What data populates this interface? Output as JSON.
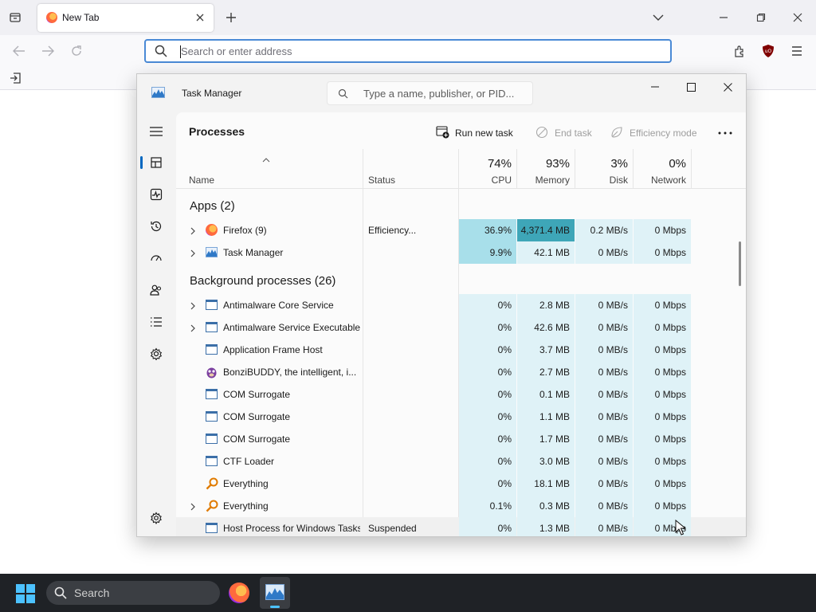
{
  "browser": {
    "tab_title": "New Tab",
    "url_placeholder": "Search or enter address"
  },
  "taskmgr": {
    "title": "Task Manager",
    "search_placeholder": "Type a name, publisher, or PID...",
    "page_title": "Processes",
    "run_new_task": "Run new task",
    "end_task": "End task",
    "efficiency_mode": "Efficiency mode",
    "columns": {
      "name": "Name",
      "status": "Status",
      "cpu_pct": "74%",
      "cpu": "CPU",
      "mem_pct": "93%",
      "mem": "Memory",
      "disk_pct": "3%",
      "disk": "Disk",
      "net_pct": "0%",
      "net": "Network"
    },
    "apps_group": "Apps (2)",
    "bg_group": "Background processes (26)",
    "apps": [
      {
        "name": "Firefox (9)",
        "status": "Efficiency...",
        "cpu": "36.9%",
        "mem": "4,371.4 MB",
        "disk": "0.2 MB/s",
        "net": "0 Mbps"
      },
      {
        "name": "Task Manager",
        "status": "",
        "cpu": "9.9%",
        "mem": "42.1 MB",
        "disk": "0 MB/s",
        "net": "0 Mbps"
      }
    ],
    "bg": [
      {
        "name": "Antimalware Core Service",
        "status": "",
        "cpu": "0%",
        "mem": "2.8 MB",
        "disk": "0 MB/s",
        "net": "0 Mbps"
      },
      {
        "name": "Antimalware Service Executable",
        "status": "",
        "cpu": "0%",
        "mem": "42.6 MB",
        "disk": "0 MB/s",
        "net": "0 Mbps"
      },
      {
        "name": "Application Frame Host",
        "status": "",
        "cpu": "0%",
        "mem": "3.7 MB",
        "disk": "0 MB/s",
        "net": "0 Mbps"
      },
      {
        "name": "BonziBUDDY, the intelligent, i...",
        "status": "",
        "cpu": "0%",
        "mem": "2.7 MB",
        "disk": "0 MB/s",
        "net": "0 Mbps"
      },
      {
        "name": "COM Surrogate",
        "status": "",
        "cpu": "0%",
        "mem": "0.1 MB",
        "disk": "0 MB/s",
        "net": "0 Mbps"
      },
      {
        "name": "COM Surrogate",
        "status": "",
        "cpu": "0%",
        "mem": "1.1 MB",
        "disk": "0 MB/s",
        "net": "0 Mbps"
      },
      {
        "name": "COM Surrogate",
        "status": "",
        "cpu": "0%",
        "mem": "1.7 MB",
        "disk": "0 MB/s",
        "net": "0 Mbps"
      },
      {
        "name": "CTF Loader",
        "status": "",
        "cpu": "0%",
        "mem": "3.0 MB",
        "disk": "0 MB/s",
        "net": "0 Mbps"
      },
      {
        "name": "Everything",
        "status": "",
        "cpu": "0%",
        "mem": "18.1 MB",
        "disk": "0 MB/s",
        "net": "0 Mbps"
      },
      {
        "name": "Everything",
        "status": "",
        "cpu": "0.1%",
        "mem": "0.3 MB",
        "disk": "0 MB/s",
        "net": "0 Mbps"
      },
      {
        "name": "Host Process for Windows Tasks",
        "status": "Suspended",
        "cpu": "0%",
        "mem": "1.3 MB",
        "disk": "0 MB/s",
        "net": "0 Mbps"
      }
    ]
  },
  "taskbar": {
    "search_label": "Search"
  },
  "colors": {
    "accent": "#0067c0",
    "heat_light": "#dff2f7",
    "heat_medium": "#a8dfea",
    "heat_high": "#3ea6b8"
  }
}
